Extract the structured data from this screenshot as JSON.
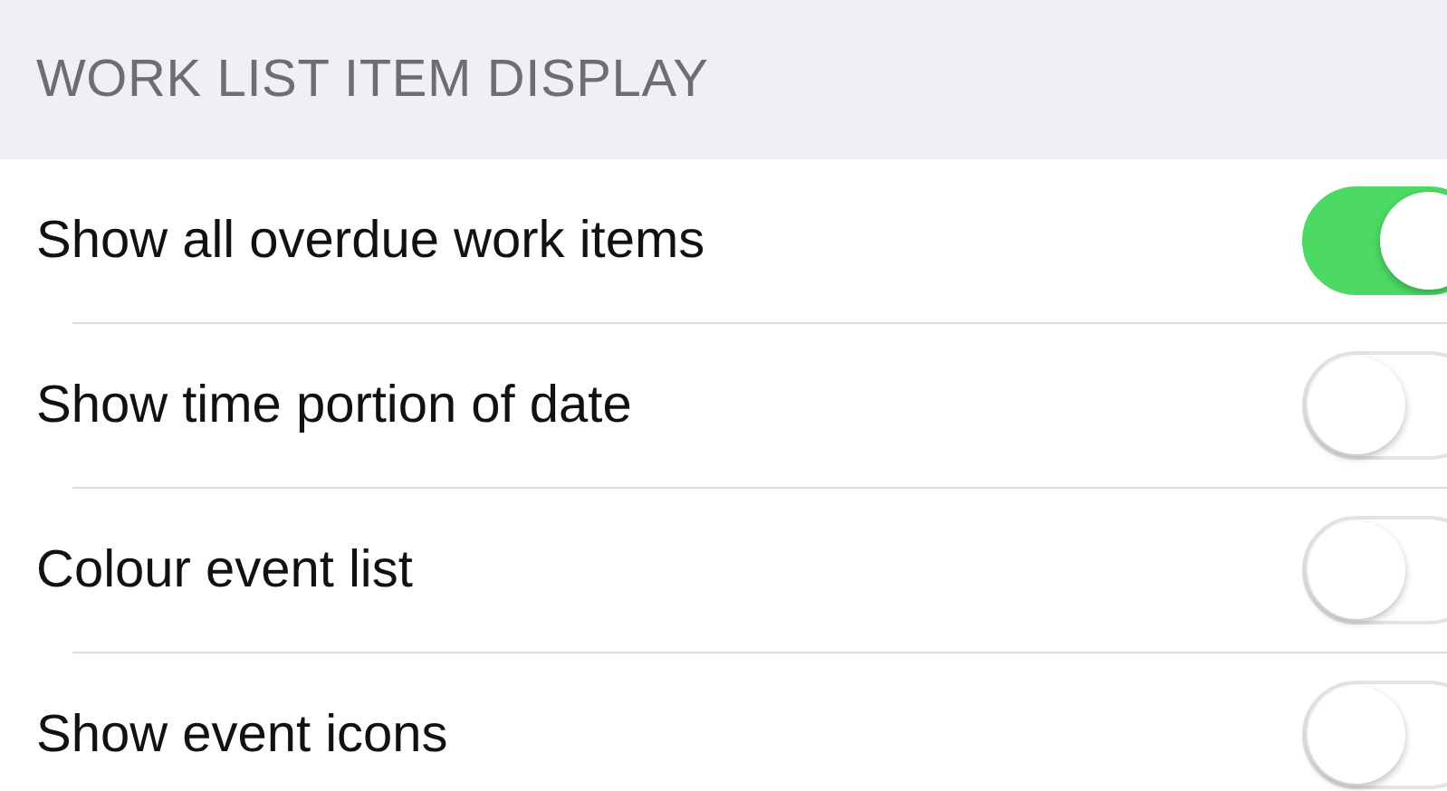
{
  "section": {
    "title": "WORK LIST ITEM DISPLAY"
  },
  "settings": [
    {
      "label": "Show all overdue work items",
      "on": true
    },
    {
      "label": "Show time portion of date",
      "on": false
    },
    {
      "label": "Colour event list",
      "on": false
    },
    {
      "label": "Show event icons",
      "on": false
    }
  ]
}
